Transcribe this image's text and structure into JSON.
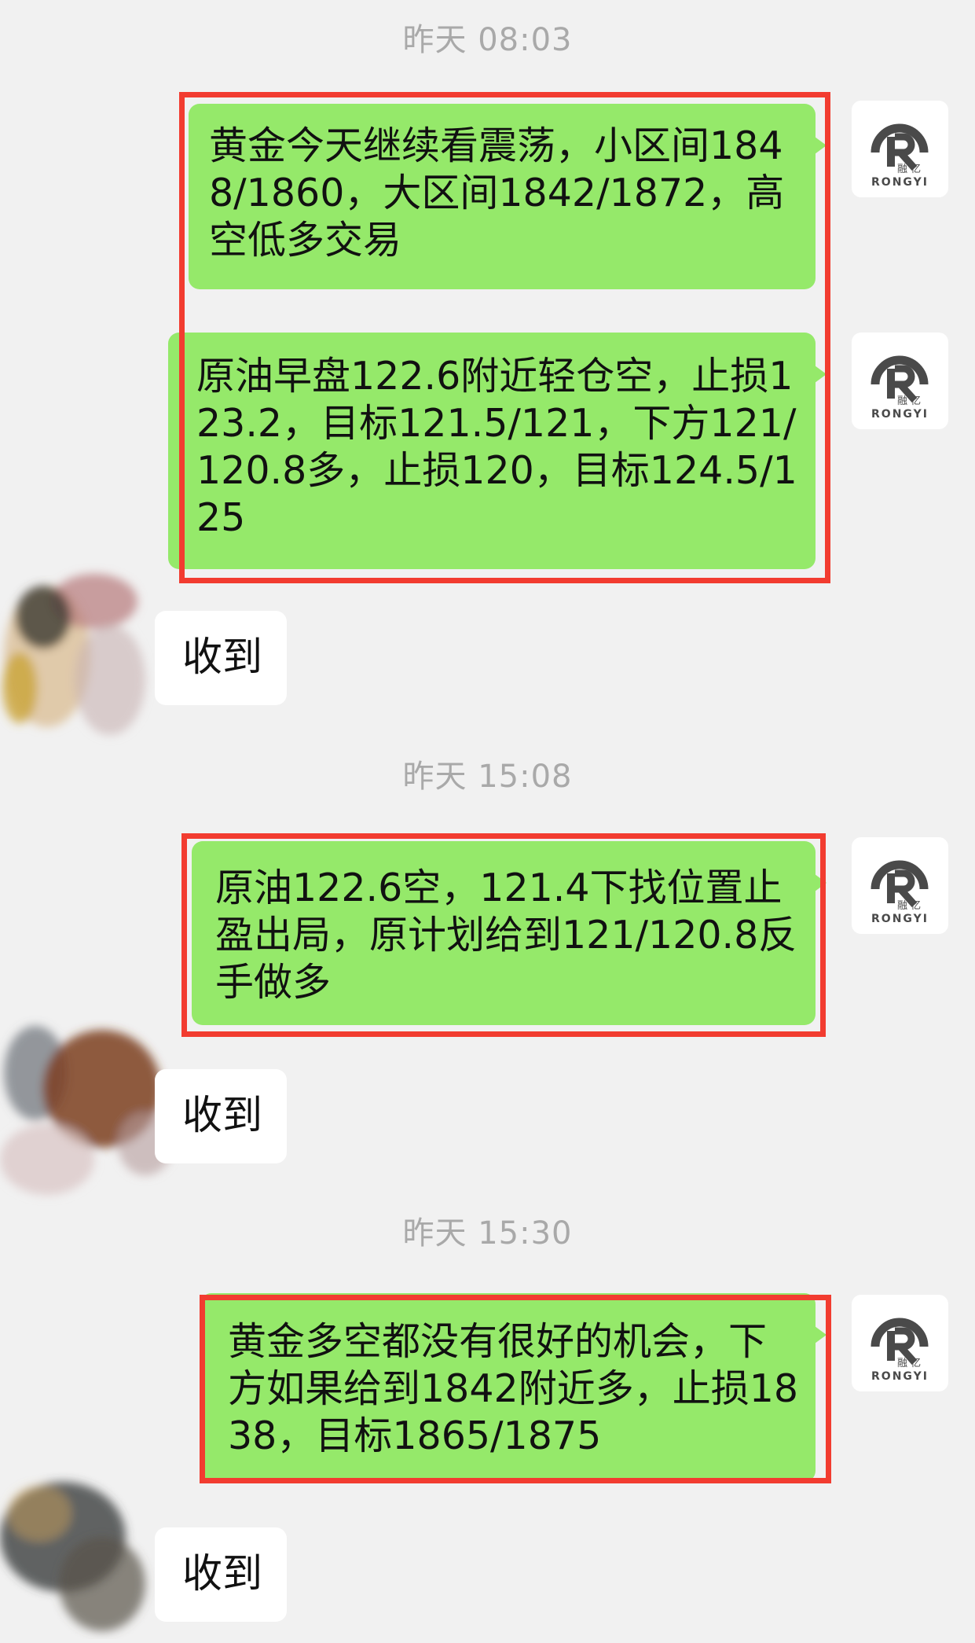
{
  "timestamps": [
    "昨天 08:03",
    "昨天 15:08",
    "昨天 15:30"
  ],
  "sender_avatar": {
    "icon": "rongyi-logo-icon",
    "brand_text": "RONGYI",
    "brand_chars": "融 亿"
  },
  "messages": [
    {
      "text": "黄金今天继续看震荡，小区间1848/1860，大区间1842/1872，高空低多交易"
    },
    {
      "text": "原油早盘122.6附近轻仓空，止损123.2，目标121.5/121，下方121/120.8多，止损120，目标124.5/125"
    },
    {
      "text": "原油122.6空，121.4下找位置止盈出局，原计划给到121/120.8反手做多"
    },
    {
      "text": "黄金多空都没有很好的机会，下方如果给到1842附近多，止损1838，目标1865/1875"
    }
  ],
  "replies": [
    "收到",
    "收到",
    "收到"
  ],
  "colors": {
    "bubble_green": "#95e96a",
    "highlight_red": "#f23c30",
    "background": "#f1f1f1"
  }
}
